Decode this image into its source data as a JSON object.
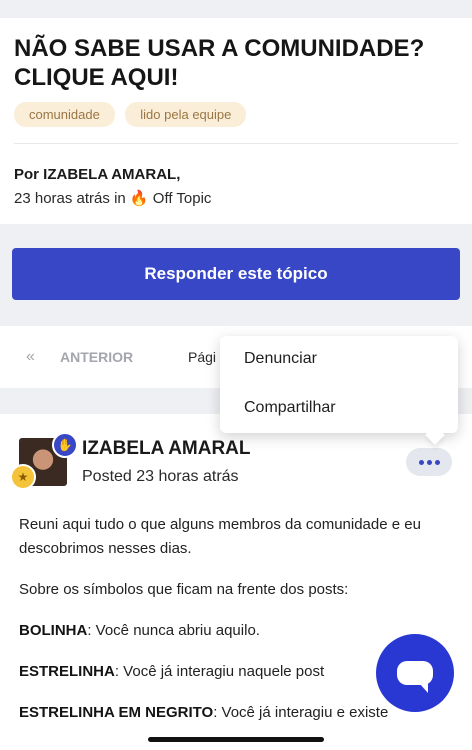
{
  "topic": {
    "title": "NÃO SABE USAR A COMUNIDADE? CLIQUE AQUI!",
    "tags": [
      "comunidade",
      "lido pela equipe"
    ],
    "author_line": "Por IZABELA AMARAL,",
    "time": "23 horas atrás",
    "in_word": "in",
    "category_emoji": "🔥",
    "category": "Off Topic"
  },
  "reply_button": "Responder este tópico",
  "pager": {
    "prev_icon": "«",
    "prev_label": "ANTERIOR",
    "page_label": "Pági"
  },
  "menu": {
    "items": [
      "Denunciar",
      "Compartilhar"
    ]
  },
  "post": {
    "author": "IZABELA AMARAL",
    "posted": "Posted 23 horas atrás",
    "paragraphs": [
      {
        "bold": "",
        "text": "Reuni aqui tudo o que alguns membros da comunidade e eu descobrimos nesses dias."
      },
      {
        "bold": "",
        "text": "Sobre os símbolos que ficam na frente dos posts:"
      },
      {
        "bold": "BOLINHA",
        "text": ": Você nunca abriu aquilo."
      },
      {
        "bold": "ESTRELINHA",
        "text": ": Você já interagiu naquele post"
      },
      {
        "bold": "ESTRELINHA EM NEGRITO",
        "text": ": Você já interagiu e existe"
      }
    ]
  },
  "icons": {
    "prev": "double-chevron-left-icon",
    "more": "more-dots-icon",
    "chat": "chat-bubble-icon",
    "badge": "hand-badge-icon",
    "medal": "medal-icon",
    "fire": "fire-icon"
  },
  "colors": {
    "primary": "#3747c6",
    "tag_bg": "#fbeed8",
    "tag_text": "#9a7645",
    "chat_fab": "#2937d3"
  }
}
